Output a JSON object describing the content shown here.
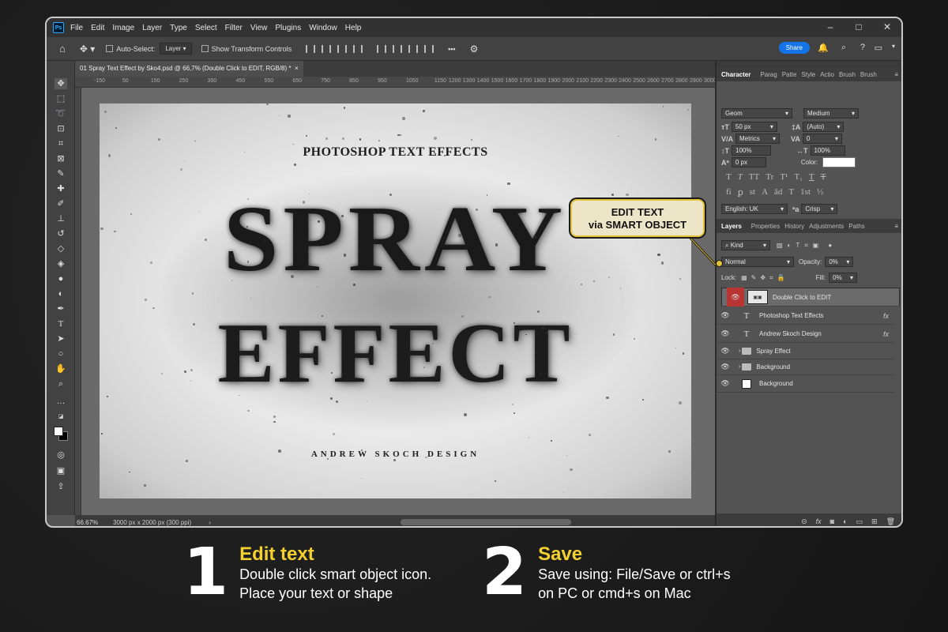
{
  "menu": [
    "File",
    "Edit",
    "Image",
    "Layer",
    "Type",
    "Select",
    "Filter",
    "View",
    "Plugins",
    "Window",
    "Help"
  ],
  "app_logo": "Ps",
  "window_controls": [
    "–",
    "□",
    "✕"
  ],
  "options": {
    "auto_select_label": "Auto-Select:",
    "auto_select_value": "Layer",
    "transform_label": "Show Transform Controls",
    "more": "•••",
    "share": "Share"
  },
  "doc_tab": "01 Spray Text Effect by Sko4.psd @ 66,7% (Double Click to EDIT, RGB/8) *",
  "doc_tab_close": "×",
  "ruler_ticks": [
    "-150",
    "0",
    "50",
    "100",
    "150",
    "200",
    "250",
    "300",
    "350",
    "400",
    "450",
    "500",
    "550",
    "600",
    "650",
    "700",
    "750",
    "800",
    "850",
    "900",
    "950",
    "1000",
    "1050",
    "1100",
    "1150",
    "1200",
    "1300",
    "1400",
    "1500",
    "1600",
    "1700",
    "1800",
    "1900",
    "2000",
    "2100",
    "2200",
    "2300",
    "2400",
    "2500",
    "2600",
    "2700",
    "2800",
    "2900",
    "3000"
  ],
  "artwork": {
    "title": "PHOTOSHOP TEXT EFFECTS",
    "word1": "SPRAY",
    "word2": "EFFECT",
    "credit": "ANDREW SKOCH DESIGN"
  },
  "status": {
    "zoom": "66.67%",
    "info": "3000 px x 2000 px (300 ppi)",
    "arrow": "›"
  },
  "character_panel": {
    "tabs": [
      "Character",
      "Parag",
      "Patte",
      "Style",
      "Actio",
      "Brush",
      "Brush"
    ],
    "font_family": "Geom",
    "font_style": "Medium",
    "size": "50 px",
    "leading": "(Auto)",
    "kerning": "Metrics",
    "tracking": "0",
    "vscale": "100%",
    "hscale": "100%",
    "baseline": "0 px",
    "color_label": "Color:",
    "language": "English: UK",
    "aa": "Crisp",
    "glyph_row1": [
      "T",
      "T",
      "TT",
      "Tr",
      "T¹",
      "T₁",
      "T",
      "T"
    ],
    "glyph_row2": [
      "fi",
      "ꝑ",
      "st",
      "A",
      "ād",
      "T",
      "1st",
      "½"
    ]
  },
  "layers_panel": {
    "tabs": [
      "Layers",
      "Properties",
      "History",
      "Adjustments",
      "Paths"
    ],
    "kind": "Kind",
    "blend": "Normal",
    "opacity_label": "Opacity:",
    "opacity": "0%",
    "lock_label": "Lock:",
    "fill_label": "Fill:",
    "fill": "0%",
    "layers": [
      {
        "name": "Double Click to EDIT",
        "type": "smart",
        "selected": true
      },
      {
        "name": "Photoshop Text Effects",
        "type": "text",
        "fx": "fx"
      },
      {
        "name": "Andrew Skoch Design",
        "type": "text",
        "fx": "fx"
      },
      {
        "name": "Spray Effect",
        "type": "group"
      },
      {
        "name": "Background",
        "type": "group"
      },
      {
        "name": "Background",
        "type": "fill"
      }
    ]
  },
  "callout": {
    "line1": "EDIT TEXT",
    "line2": "via SMART OBJECT"
  },
  "steps": [
    {
      "number": "1",
      "title": "Edit text",
      "line1": "Double click smart object icon.",
      "line2": "Place your text or shape"
    },
    {
      "number": "2",
      "title": "Save",
      "line1": "Save using: File/Save or ctrl+s",
      "line2": "on PC or cmd+s on Mac"
    }
  ],
  "colors": {
    "accent_yellow": "#f3cf2f",
    "share_blue": "#1473e6",
    "eye_red": "#b93434"
  }
}
